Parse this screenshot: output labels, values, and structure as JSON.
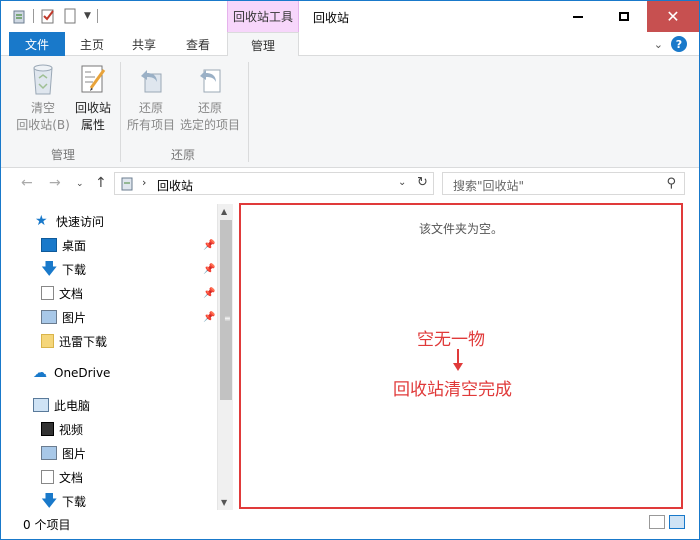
{
  "window": {
    "title": "回收站",
    "contextual_tab_group": "回收站工具"
  },
  "tabs": [
    {
      "label": "文件"
    },
    {
      "label": "主页"
    },
    {
      "label": "共享"
    },
    {
      "label": "查看"
    },
    {
      "label": "管理"
    }
  ],
  "ribbon": {
    "empty_line1": "清空",
    "empty_line2": "回收站(B)",
    "props_line1": "回收站",
    "props_line2": "属性",
    "group_manage": "管理",
    "restore_all_line1": "还原",
    "restore_all_line2": "所有项目",
    "restore_sel_line1": "还原",
    "restore_sel_line2": "选定的项目",
    "group_restore": "还原"
  },
  "address": {
    "path": "回收站",
    "search_placeholder": "搜索\"回收站\""
  },
  "nav": {
    "quick_access": "快速访问",
    "desktop": "桌面",
    "downloads": "下载",
    "documents": "文档",
    "pictures": "图片",
    "xunlei": "迅雷下载",
    "onedrive": "OneDrive",
    "this_pc": "此电脑",
    "videos": "视频",
    "pictures2": "图片",
    "documents2": "文档",
    "downloads2": "下载"
  },
  "content": {
    "empty_message": "该文件夹为空。",
    "annotation_top": "空无一物",
    "annotation_bottom": "回收站清空完成"
  },
  "status": {
    "item_count": "0 个项目"
  },
  "colors": {
    "accent": "#1979ca",
    "close": "#c75050",
    "annotation": "#e03a3a",
    "contextual_tab": "#f7d6fb"
  }
}
